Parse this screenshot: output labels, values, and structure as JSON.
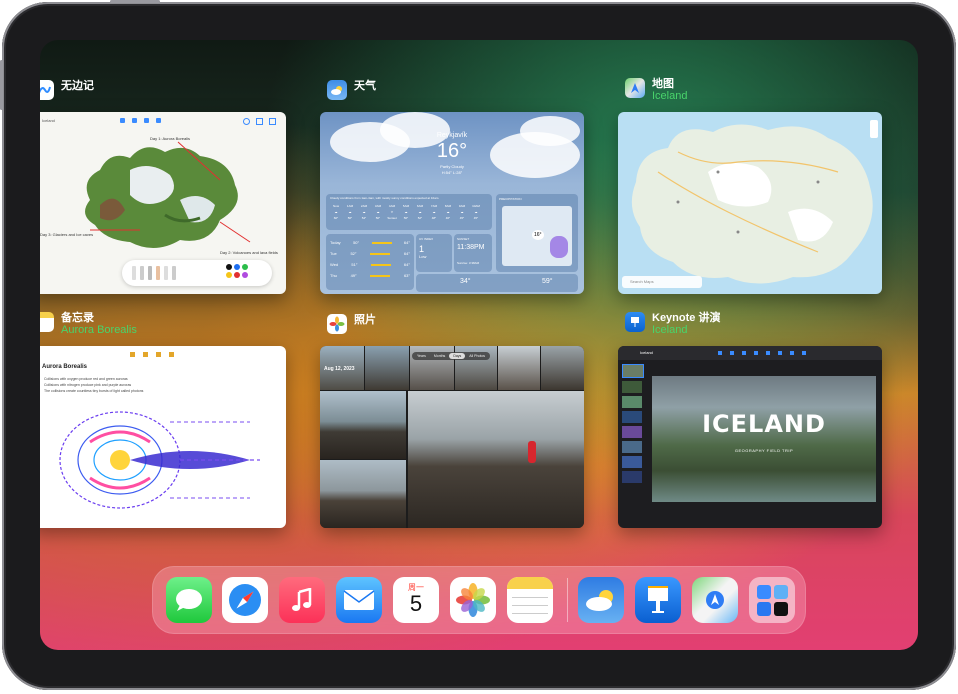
{
  "apps": [
    {
      "title": "无边记",
      "subtitle": ""
    },
    {
      "title": "天气",
      "subtitle": ""
    },
    {
      "title": "地图",
      "subtitle": "Iceland"
    },
    {
      "title": "备忘录",
      "subtitle": "Aurora Borealis"
    },
    {
      "title": "照片",
      "subtitle": ""
    },
    {
      "title": "Keynote 讲演",
      "subtitle": "Iceland"
    }
  ],
  "freeform": {
    "doc_title": "Iceland",
    "note1": "Day 1: Aurora Borealis",
    "note2": "Day 3: Glaciers and Ice caves",
    "note3": "Day 2: Volcanoes and lava fields"
  },
  "weather": {
    "city": "Reykjavík",
    "temp": "16°",
    "condition": "Partly Cloudy",
    "hilo": "H:54° L:28°",
    "forecast_note": "Cloudy conditions from 1am-4am, with mostly sunny conditions expected at 10am.",
    "hours": [
      "Now",
      "1AM",
      "2AM",
      "3AM",
      "4AM",
      "5AM",
      "6AM",
      "7AM",
      "8AM",
      "9AM",
      "10AM",
      "11AM"
    ],
    "hour_temps": [
      "60°",
      "56°",
      "54°",
      "50°",
      "Sunset",
      "56°",
      "52°",
      "48°",
      "46°",
      "45°",
      "45°",
      "45°"
    ],
    "days": [
      {
        "d": "Today",
        "lo": "50°",
        "hi": "64°"
      },
      {
        "d": "Tue",
        "lo": "52°",
        "hi": "64°"
      },
      {
        "d": "Wed",
        "lo": "51°",
        "hi": "64°"
      },
      {
        "d": "Thu",
        "lo": "49°",
        "hi": "63°"
      }
    ],
    "uv_label": "UV INDEX",
    "uv_value": "1",
    "uv_text": "Low",
    "sunset_label": "SUNSET",
    "sunset_time": "11:38PM",
    "sunrise_text": "Sunrise: 3:38AM",
    "precip_label": "PRECIPITATION",
    "precip_value": "0\"",
    "bottom_vals": [
      "34°",
      "59°"
    ],
    "map_temp": "16°"
  },
  "maps": {
    "search_placeholder": "Search Maps"
  },
  "notes": {
    "heading": "Aurora Borealis",
    "bullets": [
      "Collisions with oxygen produce red and green auroras",
      "Collisions with nitrogen produce pink and purple auroras",
      "The collisions create countless tiny bursts of light called photons"
    ]
  },
  "photos": {
    "date": "Aug 12, 2023",
    "segments": [
      "Years",
      "Months",
      "Days",
      "All Photos"
    ]
  },
  "keynote": {
    "doc_title": "Iceland",
    "slide_title": "ICELAND",
    "slide_subtitle": "GEOGRAPHY FIELD TRIP"
  },
  "dock": {
    "calendar_weekday": "周一",
    "calendar_day": "5",
    "icons": [
      "messages-icon",
      "safari-icon",
      "music-icon",
      "mail-icon",
      "calendar-icon",
      "photos-icon",
      "notes-icon",
      "weather-icon",
      "keynote-icon",
      "maps-icon",
      "app-library-icon"
    ]
  },
  "colors": {
    "subtitle_green": "#49d46b",
    "wallpaper_pink": "#e23f72",
    "wallpaper_orange": "#c9852a"
  }
}
